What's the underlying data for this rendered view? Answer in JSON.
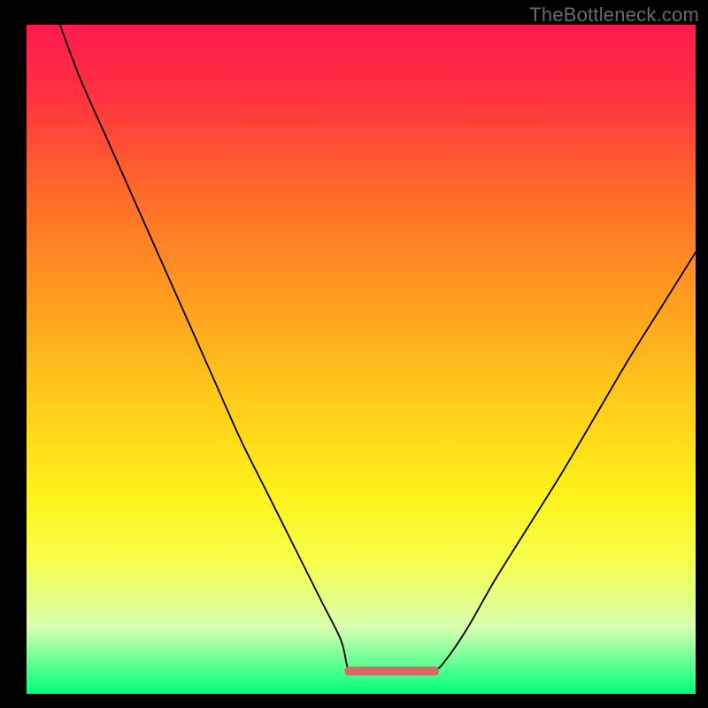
{
  "watermark": "TheBottleneck.com",
  "chart_data": {
    "type": "line",
    "title": "",
    "xlabel": "",
    "ylabel": "",
    "xlim": [
      0,
      100
    ],
    "ylim": [
      0,
      100
    ],
    "grid": false,
    "legend": false,
    "background_gradient": [
      {
        "offset": 0,
        "color": "#ff1a51"
      },
      {
        "offset": 0.1,
        "color": "#ff3040"
      },
      {
        "offset": 0.25,
        "color": "#ff6a2a"
      },
      {
        "offset": 0.4,
        "color": "#ff9a20"
      },
      {
        "offset": 0.55,
        "color": "#ffc81a"
      },
      {
        "offset": 0.7,
        "color": "#fff21a"
      },
      {
        "offset": 0.8,
        "color": "#f6ff4a"
      },
      {
        "offset": 0.9,
        "color": "#d8ffb0"
      },
      {
        "offset": 1.0,
        "color": "#00ff7b"
      }
    ],
    "flat_band": {
      "x_start": 48.2,
      "x_end": 61.0,
      "y": 3.4
    },
    "series": [
      {
        "name": "curve",
        "stroke": "#000000",
        "stroke_width": 1.8,
        "x": [
          5.0,
          8.0,
          12.0,
          16.0,
          20.0,
          24.0,
          28.0,
          32.0,
          36.0,
          40.0,
          44.0,
          47.0,
          48.2,
          50.0,
          53.0,
          56.0,
          59.0,
          61.0,
          63.0,
          66.0,
          70.0,
          75.0,
          80.0,
          85.0,
          90.0,
          95.0,
          100.0
        ],
        "y": [
          100.0,
          92.0,
          83.0,
          74.0,
          65.0,
          56.0,
          47.0,
          38.0,
          30.0,
          22.0,
          14.0,
          8.0,
          3.4,
          3.4,
          3.4,
          3.4,
          3.4,
          3.4,
          5.5,
          10.0,
          17.0,
          25.0,
          33.0,
          41.5,
          50.0,
          58.0,
          66.0
        ]
      }
    ],
    "flat_marker": {
      "color": "#d66a6a",
      "width": 10,
      "radius": 5
    }
  }
}
